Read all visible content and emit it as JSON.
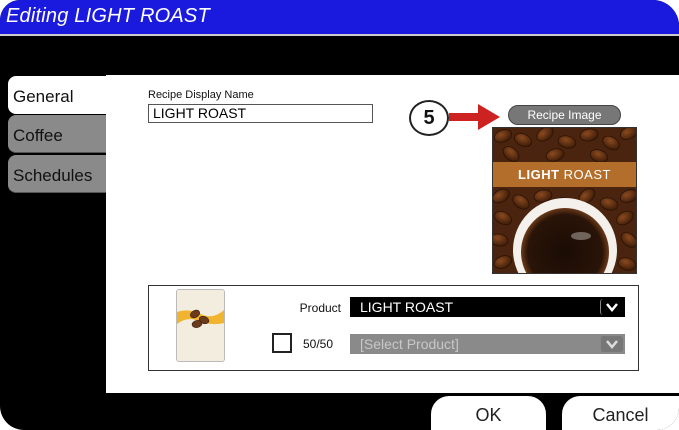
{
  "window": {
    "title": "Editing LIGHT ROAST"
  },
  "tabs": [
    {
      "label": "General",
      "active": true
    },
    {
      "label": "Coffee",
      "active": false
    },
    {
      "label": "Schedules",
      "active": false
    }
  ],
  "general": {
    "name_label": "Recipe Display Name",
    "name_value": "LIGHT ROAST",
    "callout_number": "5",
    "recipe_image_button": "Recipe Image",
    "image_banner_bold": "LIGHT",
    "image_banner_rest": " ROAST"
  },
  "product": {
    "product_label": "Product",
    "product_value": "LIGHT ROAST",
    "half_label": "50/50",
    "half_placeholder": "[Select Product]",
    "half_checked": false
  },
  "footer": {
    "ok_label": "OK",
    "cancel_label": "Cancel"
  },
  "colors": {
    "titlebar": "#1a1adf",
    "callout_arrow": "#cc2222",
    "banner": "#b46e2b"
  }
}
